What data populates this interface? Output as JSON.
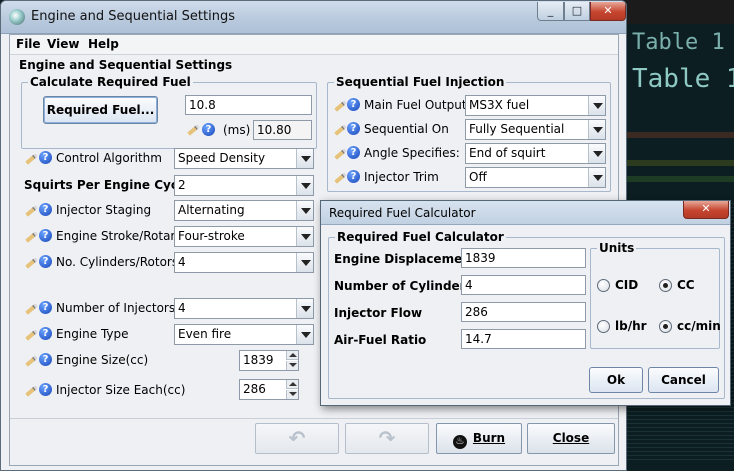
{
  "background_app": {
    "line1": "Table 1",
    "line2": "Table 1"
  },
  "window": {
    "title": "Engine and Sequential Settings",
    "menu": [
      "File",
      "View",
      "Help"
    ],
    "heading": "Engine and Sequential Settings"
  },
  "required_fuel": {
    "group_title": "Calculate Required Fuel",
    "button_label": "Required Fuel...",
    "value": "10.8",
    "unit": "(ms)",
    "ms_value": "10.80"
  },
  "sequential": {
    "group_title": "Sequential Fuel Injection",
    "rows": [
      {
        "label": "Main Fuel Outputs",
        "value": "MS3X fuel"
      },
      {
        "label": "Sequential On",
        "value": "Fully Sequential"
      },
      {
        "label": "Angle Specifies:",
        "value": "End of squirt"
      },
      {
        "label": "Injector Trim",
        "value": "Off"
      }
    ]
  },
  "engine": {
    "control_algorithm": {
      "label": "Control Algorithm",
      "value": "Speed Density"
    },
    "squirts": {
      "label": "Squirts Per Engine Cycle",
      "value": "2"
    },
    "injector_staging": {
      "label": "Injector Staging",
      "value": "Alternating"
    },
    "engine_stroke": {
      "label": "Engine Stroke/Rotary",
      "value": "Four-stroke"
    },
    "cylinders": {
      "label": "No. Cylinders/Rotors",
      "value": "4"
    },
    "num_injectors": {
      "label": "Number of Injectors",
      "value": "4"
    },
    "engine_type": {
      "label": "Engine Type",
      "value": "Even fire"
    },
    "engine_size": {
      "label": "Engine Size(cc)",
      "value": "1839"
    },
    "injector_size": {
      "label": "Injector Size Each(cc)",
      "value": "286"
    }
  },
  "bottom_buttons": {
    "burn": "Burn",
    "close": "Close"
  },
  "dialog": {
    "title": "Required Fuel Calculator",
    "group_title": "Required Fuel Calculator",
    "fields": [
      {
        "label": "Engine Displacement",
        "value": "1839"
      },
      {
        "label": "Number of Cylinders",
        "value": "4"
      },
      {
        "label": "Injector Flow",
        "value": "286"
      },
      {
        "label": "Air-Fuel Ratio",
        "value": "14.7"
      }
    ],
    "units_title": "Units",
    "units": {
      "cid": "CID",
      "cc": "CC",
      "lbhr": "lb/hr",
      "ccmin": "cc/min"
    },
    "ok": "Ok",
    "cancel": "Cancel"
  }
}
